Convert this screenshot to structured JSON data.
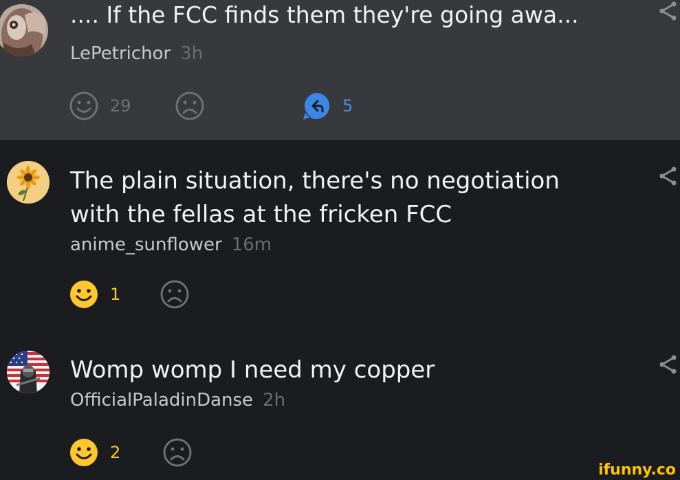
{
  "comments": [
    {
      "text_lines": [
        ".... If the FCC finds them they're going awa..."
      ],
      "username": "LePetrichor",
      "time": "3h",
      "likes": "29",
      "replies": "5",
      "liked": false,
      "highlighted": true,
      "avatar_icon": "owl-avatar"
    },
    {
      "text_lines": [
        "The plain situation, there's no negotiation",
        "with the fellas at the fricken FCC"
      ],
      "username": "anime_sunflower",
      "time": "16m",
      "likes": "1",
      "liked": true,
      "highlighted": false,
      "avatar_icon": "sunflower-avatar"
    },
    {
      "text_lines": [
        "Womp womp I need my copper"
      ],
      "username": "OfficialPaladinDanse",
      "time": "2h",
      "likes": "2",
      "liked": true,
      "highlighted": false,
      "avatar_icon": "us-flag-soldier-avatar"
    }
  ],
  "watermark": "ifunny.co",
  "colors": {
    "background": "#1b1c1f",
    "highlight_background": "#38393d",
    "liked_yellow": "#ffc72c",
    "reply_blue": "#4a8fe6",
    "muted_grey": "#6f7074"
  }
}
